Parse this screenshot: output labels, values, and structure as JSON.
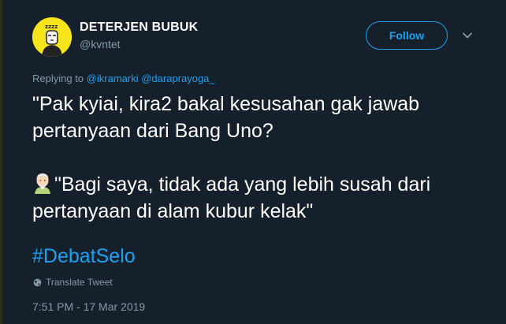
{
  "tweet": {
    "display_name": "DETERJEN BUBUK",
    "username": "@kvntet",
    "follow_label": "Follow",
    "replying_prefix": "Replying to",
    "mentions": [
      "@ikramarki",
      "@daraprayoga_"
    ],
    "text_paragraph_1": "\"Pak kyiai, kira2 bakal kesusahan gak jawab pertanyaan dari Bang Uno?",
    "text_paragraph_2": "\"Bagi saya, tidak ada yang lebih susah dari pertanyaan di alam kubur kelak\"",
    "hashtag": "#DebatSelo",
    "translate_label": "Translate Tweet",
    "timestamp": "7:51 PM - 17 Mar 2019"
  },
  "icons": {
    "avatar": "cartoon-avatar-icon",
    "chevron": "chevron-down-icon",
    "globe": "globe-icon",
    "emoji": "older-man-emoji-icon"
  },
  "colors": {
    "background": "#15202b",
    "accent": "#1da1f2",
    "secondary_text": "#8899a6",
    "primary_text": "#ffffff",
    "avatar_bg": "#f7e51c"
  }
}
